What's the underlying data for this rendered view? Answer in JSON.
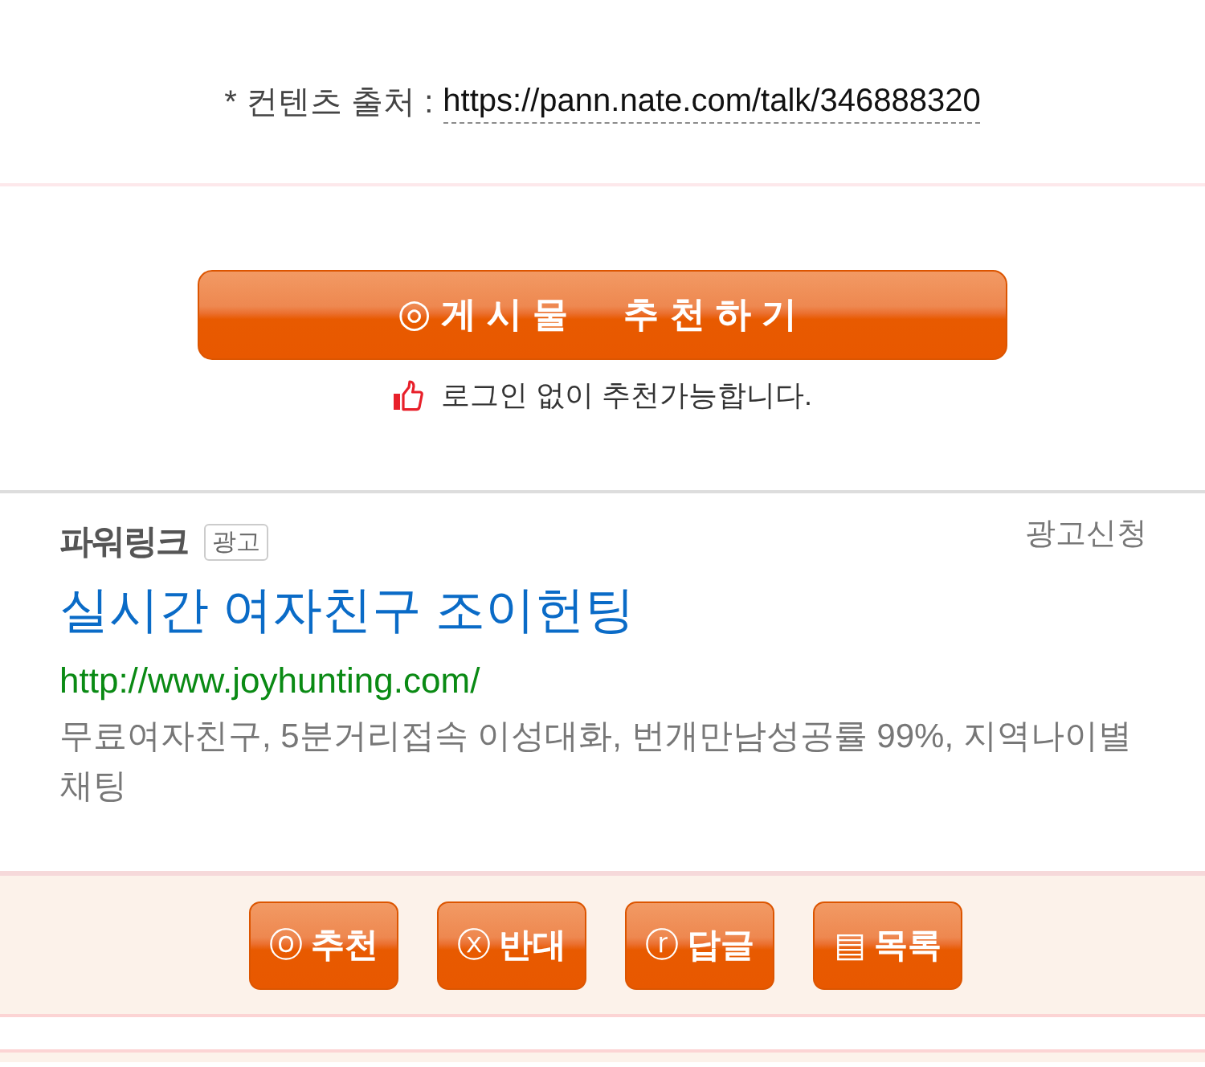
{
  "source": {
    "label": "* 컨텐츠 출처 :",
    "link": "https://pann.nate.com/talk/346888320"
  },
  "recommend": {
    "icon": "◎",
    "label": "게시물 추천하기",
    "note": "로그인 없이 추천가능합니다."
  },
  "ad": {
    "brand": "파워링크",
    "badge": "광고",
    "apply_link": "광고신청",
    "title": "실시간 여자친구 조이헌팅",
    "url": "http://www.joyhunting.com/",
    "description": "무료여자친구, 5분거리접속 이성대화, 번개만남성공률 99%, 지역나이별 채팅"
  },
  "actions": [
    {
      "icon": "ⓞ",
      "label": "추천"
    },
    {
      "icon": "ⓧ",
      "label": "반대"
    },
    {
      "icon": "ⓡ",
      "label": "답글"
    },
    {
      "icon": "▤",
      "label": "목록"
    }
  ]
}
